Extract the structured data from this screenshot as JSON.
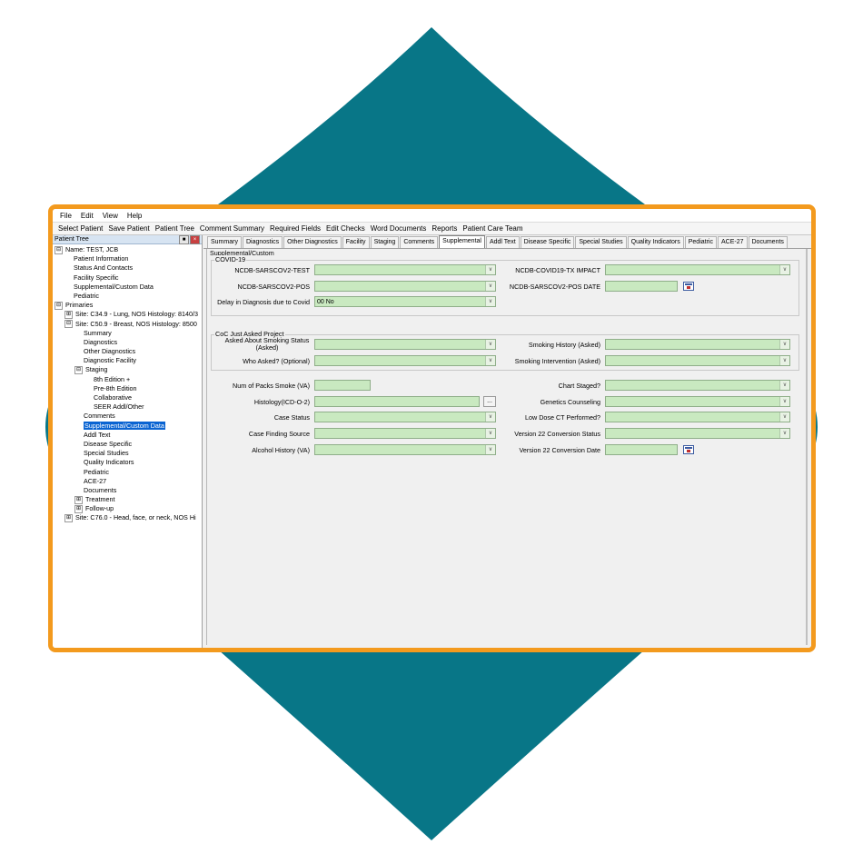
{
  "colors": {
    "teal": "#087687",
    "orange": "#f39a1e",
    "field_green": "#c9e9c0",
    "selection_blue": "#0a64d2"
  },
  "menu": [
    "File",
    "Edit",
    "View",
    "Help"
  ],
  "toolbar": [
    "Select Patient",
    "Save Patient",
    "Patient Tree",
    "Comment Summary",
    "Required Fields",
    "Edit Checks",
    "Word Documents",
    "Reports",
    "Patient Care Team"
  ],
  "left_panel": {
    "title": "Patient Tree",
    "pin_icon": "pin-icon",
    "close_icon": "close-icon"
  },
  "tree": [
    {
      "level": 0,
      "toggle": "⊟",
      "label": "Name: TEST, JCB"
    },
    {
      "level": 1,
      "label": "Patient Information"
    },
    {
      "level": 1,
      "label": "Status And Contacts"
    },
    {
      "level": 1,
      "label": "Facility Specific"
    },
    {
      "level": 1,
      "label": "Supplemental/Custom Data"
    },
    {
      "level": 1,
      "label": "Pediatric"
    },
    {
      "level": 0,
      "toggle": "⊟",
      "label": "Primaries"
    },
    {
      "level": 1,
      "toggle": "⊞",
      "label": "Site: C34.9 - Lung, NOS Histology: 8140/3"
    },
    {
      "level": 1,
      "toggle": "⊟",
      "label": "Site: C50.9 - Breast, NOS Histology: 8500"
    },
    {
      "level": 2,
      "label": "Summary"
    },
    {
      "level": 2,
      "label": "Diagnostics"
    },
    {
      "level": 2,
      "label": "Other Diagnostics"
    },
    {
      "level": 2,
      "label": "Diagnostic Facility"
    },
    {
      "level": 2,
      "toggle": "⊟",
      "label": "Staging"
    },
    {
      "level": 3,
      "label": "8th Edition +"
    },
    {
      "level": 3,
      "label": "Pre-8th Edition"
    },
    {
      "level": 3,
      "label": "Collaborative"
    },
    {
      "level": 3,
      "label": "SEER Addl/Other"
    },
    {
      "level": 2,
      "label": "Comments"
    },
    {
      "level": 2,
      "label": "Supplemental/Custom Data",
      "selected": true
    },
    {
      "level": 2,
      "label": "Addl Text"
    },
    {
      "level": 2,
      "label": "Disease Specific"
    },
    {
      "level": 2,
      "label": "Special Studies"
    },
    {
      "level": 2,
      "label": "Quality Indicators"
    },
    {
      "level": 2,
      "label": "Pediatric"
    },
    {
      "level": 2,
      "label": "ACE-27"
    },
    {
      "level": 2,
      "label": "Documents"
    },
    {
      "level": 2,
      "toggle": "⊞",
      "label": "Treatment"
    },
    {
      "level": 2,
      "toggle": "⊞",
      "label": "Follow-up"
    },
    {
      "level": 1,
      "toggle": "⊞",
      "label": "Site: C76.0 - Head, face, or neck, NOS Hi"
    }
  ],
  "tabs": [
    "Summary",
    "Diagnostics",
    "Other Diagnostics",
    "Facility",
    "Staging",
    "Comments",
    "Supplemental",
    "Addl Text",
    "Disease Specific",
    "Special Studies",
    "Quality Indicators",
    "Pediatric",
    "ACE-27",
    "Documents"
  ],
  "active_tab": "Supplemental",
  "form": {
    "outer_group": "Supplemental/Custom",
    "covid_group": "COVID-19",
    "covid": {
      "sarscov2_test": "NCDB-SARSCOV2-TEST",
      "sarscov2_pos": "NCDB-SARSCOV2-POS",
      "delay_label": "Delay in Diagnosis due to Covid",
      "delay_value": "00 No",
      "tx_impact": "NCDB-COVID19-TX IMPACT",
      "pos_date": "NCDB-SARSCOV2-POS DATE"
    },
    "coc_group": "CoC Just Asked Project",
    "coc": {
      "smoking_status": "Asked About Smoking Status (Asked)",
      "who_asked": "Who Asked? (Optional)",
      "smoking_history": "Smoking History (Asked)",
      "smoking_intervention": "Smoking Intervention (Asked)"
    },
    "misc": {
      "num_packs": "Num of Packs Smoke (VA)",
      "histology": "Histology(ICD-O-2)",
      "case_status": "Case Status",
      "case_finding": "Case Finding Source",
      "alcohol": "Alcohol History (VA)",
      "chart_staged": "Chart Staged?",
      "genetics": "Genetics Counseling",
      "low_dose": "Low Dose CT Performed?",
      "v22_status": "Version 22 Conversion Status",
      "v22_date": "Version 22 Conversion Date"
    },
    "ellipsis": "...",
    "dropdown_glyph": "∨"
  }
}
